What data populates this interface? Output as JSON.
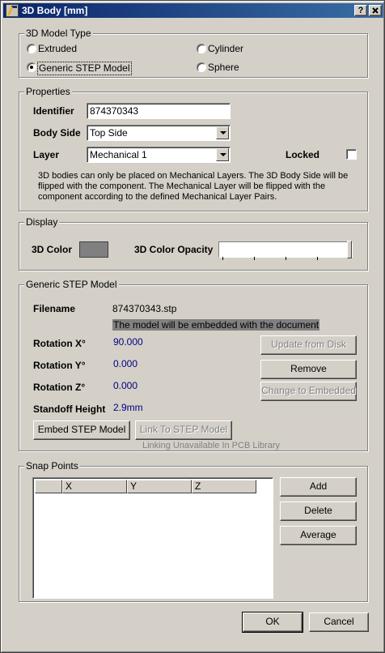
{
  "window": {
    "title": "3D Body [mm]",
    "help_button": "?",
    "close_button": "X"
  },
  "model_type": {
    "legend": "3D Model Type",
    "options": {
      "extruded": "Extruded",
      "cylinder": "Cylinder",
      "generic_step": "Generic STEP Model",
      "sphere": "Sphere"
    },
    "selected": "Generic STEP Model"
  },
  "properties": {
    "legend": "Properties",
    "identifier_label": "Identifier",
    "identifier_value": "874370343",
    "body_side_label": "Body Side",
    "body_side_value": "Top Side",
    "layer_label": "Layer",
    "layer_value": "Mechanical 1",
    "locked_label": "Locked",
    "locked_checked": false,
    "note_line1": "3D bodies can only be placed on Mechanical Layers. The 3D Body Side will be",
    "note_line2": "flipped with the component. The Mechanical Layer will be flipped with the",
    "note_line3": "component according to the defined Mechanical Layer Pairs."
  },
  "display": {
    "legend": "Display",
    "color_label": "3D Color",
    "color_value": "#808080",
    "opacity_label": "3D Color Opacity",
    "opacity_fraction": 1.0
  },
  "step_model": {
    "legend": "Generic STEP Model",
    "filename_label": "Filename",
    "filename_value": "874370343.stp",
    "embed_note": "The model will be embedded with the document",
    "rotation_x_label": "Rotation X°",
    "rotation_x_value": "90.000",
    "rotation_y_label": "Rotation Y°",
    "rotation_y_value": "0.000",
    "rotation_z_label": "Rotation Z°",
    "rotation_z_value": "0.000",
    "standoff_label": "Standoff Height",
    "standoff_value": "2.9mm",
    "update_button": "Update from Disk",
    "remove_button": "Remove",
    "change_button": "Change to Embedded",
    "embed_button": "Embed STEP Model",
    "link_button": "Link To STEP Model",
    "link_note": "Linking Unavailable In PCB Library"
  },
  "snap_points": {
    "legend": "Snap Points",
    "columns": [
      "X",
      "Y",
      "Z"
    ],
    "rows": [],
    "add_button": "Add",
    "delete_button": "Delete",
    "average_button": "Average"
  },
  "footer": {
    "ok_button": "OK",
    "cancel_button": "Cancel"
  },
  "colors": {
    "dialog_bg": "#d4d0c8",
    "title_gradient_start": "#0a246a",
    "title_gradient_end": "#3a6ea5",
    "value_text": "#000080"
  }
}
